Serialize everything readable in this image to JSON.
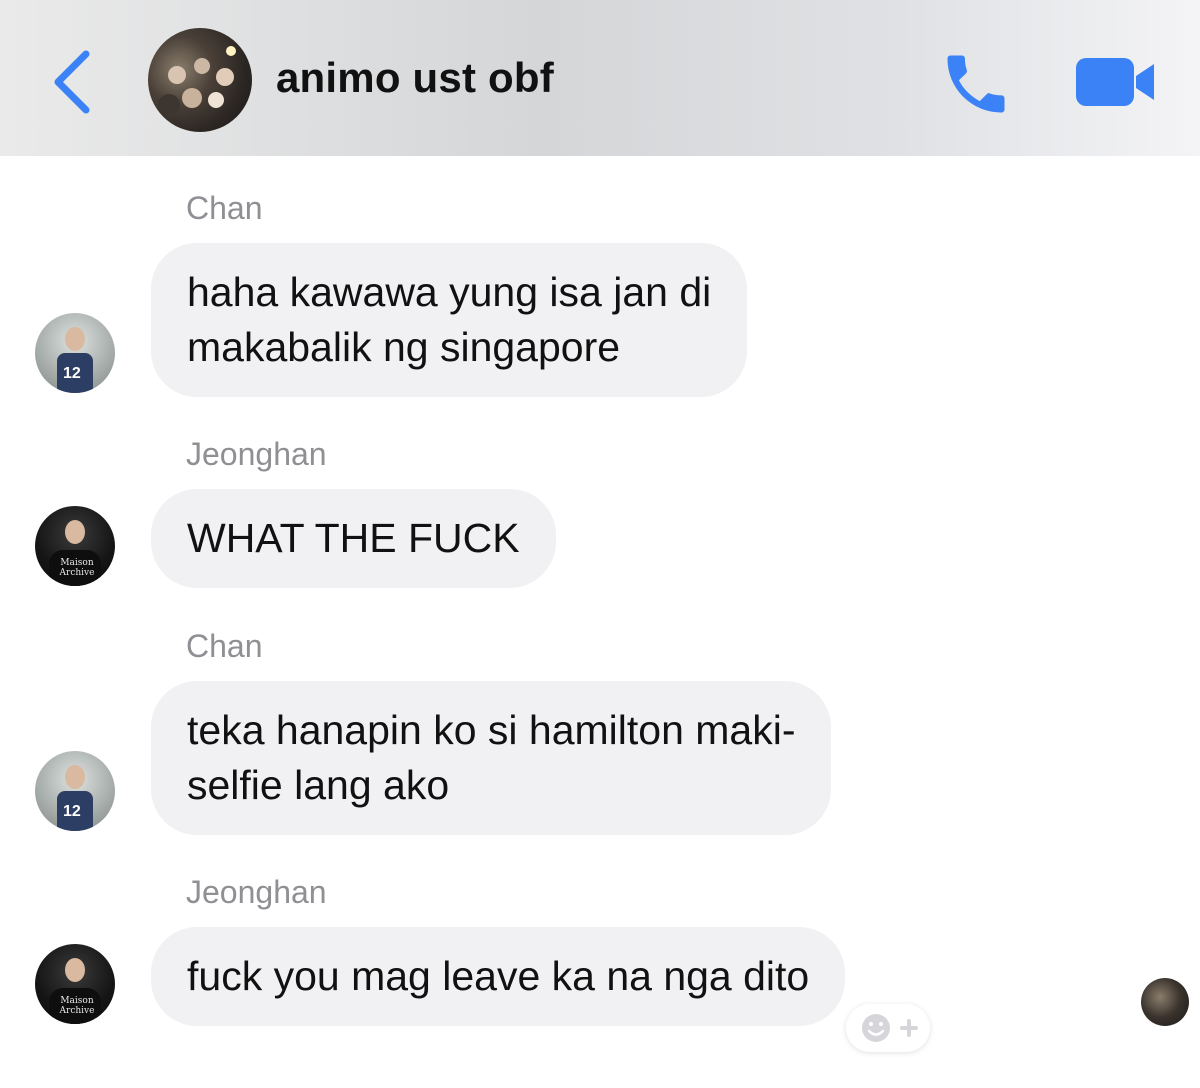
{
  "header": {
    "title": "animo ust obf",
    "back_icon": "chevron-left-icon",
    "call_icon": "phone-icon",
    "video_icon": "video-camera-icon",
    "accent_color": "#3b82f6"
  },
  "messages": [
    {
      "sender": "Chan",
      "lines": [
        "haha kawawa yung isa jan di",
        "makabalik ng singapore"
      ]
    },
    {
      "sender": "Jeonghan",
      "lines": [
        "WHAT THE FUCK"
      ]
    },
    {
      "sender": "Chan",
      "lines": [
        "teka hanapin ko si hamilton maki-",
        "selfie lang ako"
      ]
    },
    {
      "sender": "Jeonghan",
      "lines": [
        "fuck you mag leave ka na nga dito"
      ]
    }
  ],
  "avatars": {
    "chan_jersey_number": "12",
    "jeonghan_shirt_text": "Maison Archive"
  },
  "reaction_icon": "add-reaction-icon",
  "colors": {
    "bubble_bg": "#f1f1f3",
    "sender_name": "#8f8f94",
    "header_icons": "#3b82f6"
  }
}
